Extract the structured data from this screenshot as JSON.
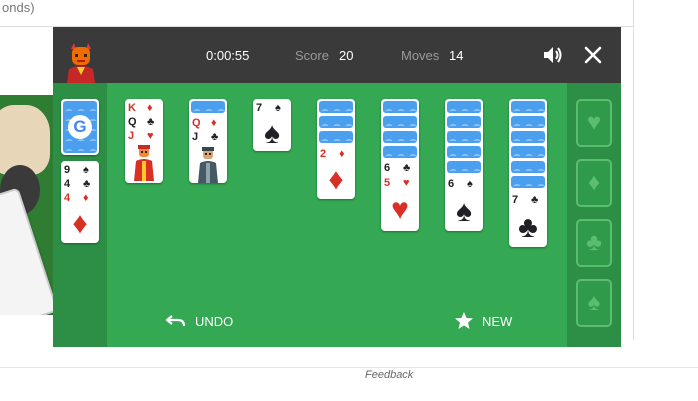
{
  "background": {
    "snippet_text": "onds)",
    "feedback_link": "Feedback"
  },
  "topbar": {
    "timer": "0:00:55",
    "score_label": "Score",
    "score_value": "20",
    "moves_label": "Moves",
    "moves_value": "14",
    "sound_icon": "speaker-icon",
    "close_icon": "close-icon"
  },
  "stock": {
    "logo_letter": "G",
    "waste": [
      {
        "rank": "9",
        "suit": "♠",
        "color": "black"
      },
      {
        "rank": "4",
        "suit": "♣",
        "color": "black"
      },
      {
        "rank": "4",
        "suit": "♦",
        "color": "red",
        "big": "♦"
      }
    ]
  },
  "tableau": [
    {
      "cards": [
        {
          "rank": "K",
          "suit": "♦",
          "color": "red"
        },
        {
          "rank": "Q",
          "suit": "♣",
          "color": "black"
        },
        {
          "rank": "J",
          "suit": "♥",
          "color": "red",
          "face": "jack-red"
        }
      ]
    },
    {
      "cards": [
        {
          "rank": "Q",
          "suit": "♦",
          "color": "red"
        },
        {
          "rank": "J",
          "suit": "♣",
          "color": "black",
          "face": "jack-black"
        }
      ]
    },
    {
      "cards": [
        {
          "rank": "7",
          "suit": "♠",
          "color": "black",
          "big": "♠"
        }
      ]
    },
    {
      "cards": [
        {
          "rank": "2",
          "suit": "♦",
          "color": "red",
          "big": "♦"
        }
      ]
    },
    {
      "cards": [
        {
          "rank": "6",
          "suit": "♣",
          "color": "black"
        },
        {
          "rank": "5",
          "suit": "♥",
          "color": "red",
          "big": "♥"
        }
      ]
    },
    {
      "cards": [
        {
          "rank": "6",
          "suit": "♠",
          "color": "black",
          "big": "♠"
        }
      ]
    },
    {
      "cards": [
        {
          "rank": "7",
          "suit": "♣",
          "color": "black",
          "big": "♣"
        }
      ]
    }
  ],
  "foundations": [
    "♥",
    "♦",
    "♣",
    "♠"
  ],
  "actions": {
    "undo_label": "UNDO",
    "new_label": "NEW"
  },
  "colors": {
    "felt": "#34a853",
    "side": "#2d8f46",
    "bar": "#3a3a3a",
    "red": "#d93025",
    "black": "#202124",
    "card_back": "#4aa0ee"
  }
}
